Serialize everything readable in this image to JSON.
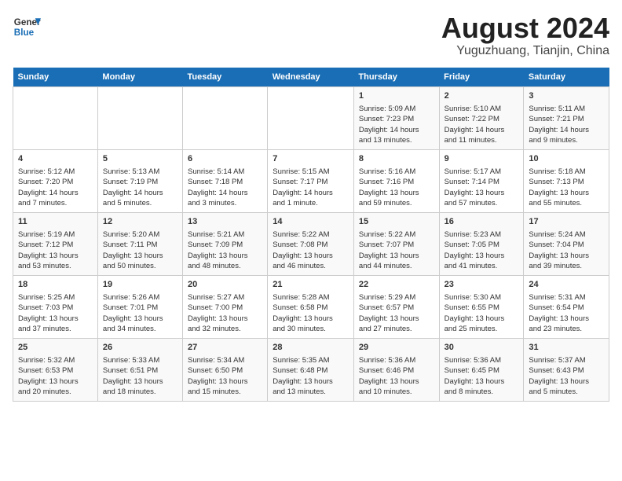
{
  "header": {
    "logo_line1": "General",
    "logo_line2": "Blue",
    "month_year": "August 2024",
    "location": "Yuguzhuang, Tianjin, China"
  },
  "weekdays": [
    "Sunday",
    "Monday",
    "Tuesday",
    "Wednesday",
    "Thursday",
    "Friday",
    "Saturday"
  ],
  "weeks": [
    [
      {
        "day": "",
        "info": ""
      },
      {
        "day": "",
        "info": ""
      },
      {
        "day": "",
        "info": ""
      },
      {
        "day": "",
        "info": ""
      },
      {
        "day": "1",
        "info": "Sunrise: 5:09 AM\nSunset: 7:23 PM\nDaylight: 14 hours\nand 13 minutes."
      },
      {
        "day": "2",
        "info": "Sunrise: 5:10 AM\nSunset: 7:22 PM\nDaylight: 14 hours\nand 11 minutes."
      },
      {
        "day": "3",
        "info": "Sunrise: 5:11 AM\nSunset: 7:21 PM\nDaylight: 14 hours\nand 9 minutes."
      }
    ],
    [
      {
        "day": "4",
        "info": "Sunrise: 5:12 AM\nSunset: 7:20 PM\nDaylight: 14 hours\nand 7 minutes."
      },
      {
        "day": "5",
        "info": "Sunrise: 5:13 AM\nSunset: 7:19 PM\nDaylight: 14 hours\nand 5 minutes."
      },
      {
        "day": "6",
        "info": "Sunrise: 5:14 AM\nSunset: 7:18 PM\nDaylight: 14 hours\nand 3 minutes."
      },
      {
        "day": "7",
        "info": "Sunrise: 5:15 AM\nSunset: 7:17 PM\nDaylight: 14 hours\nand 1 minute."
      },
      {
        "day": "8",
        "info": "Sunrise: 5:16 AM\nSunset: 7:16 PM\nDaylight: 13 hours\nand 59 minutes."
      },
      {
        "day": "9",
        "info": "Sunrise: 5:17 AM\nSunset: 7:14 PM\nDaylight: 13 hours\nand 57 minutes."
      },
      {
        "day": "10",
        "info": "Sunrise: 5:18 AM\nSunset: 7:13 PM\nDaylight: 13 hours\nand 55 minutes."
      }
    ],
    [
      {
        "day": "11",
        "info": "Sunrise: 5:19 AM\nSunset: 7:12 PM\nDaylight: 13 hours\nand 53 minutes."
      },
      {
        "day": "12",
        "info": "Sunrise: 5:20 AM\nSunset: 7:11 PM\nDaylight: 13 hours\nand 50 minutes."
      },
      {
        "day": "13",
        "info": "Sunrise: 5:21 AM\nSunset: 7:09 PM\nDaylight: 13 hours\nand 48 minutes."
      },
      {
        "day": "14",
        "info": "Sunrise: 5:22 AM\nSunset: 7:08 PM\nDaylight: 13 hours\nand 46 minutes."
      },
      {
        "day": "15",
        "info": "Sunrise: 5:22 AM\nSunset: 7:07 PM\nDaylight: 13 hours\nand 44 minutes."
      },
      {
        "day": "16",
        "info": "Sunrise: 5:23 AM\nSunset: 7:05 PM\nDaylight: 13 hours\nand 41 minutes."
      },
      {
        "day": "17",
        "info": "Sunrise: 5:24 AM\nSunset: 7:04 PM\nDaylight: 13 hours\nand 39 minutes."
      }
    ],
    [
      {
        "day": "18",
        "info": "Sunrise: 5:25 AM\nSunset: 7:03 PM\nDaylight: 13 hours\nand 37 minutes."
      },
      {
        "day": "19",
        "info": "Sunrise: 5:26 AM\nSunset: 7:01 PM\nDaylight: 13 hours\nand 34 minutes."
      },
      {
        "day": "20",
        "info": "Sunrise: 5:27 AM\nSunset: 7:00 PM\nDaylight: 13 hours\nand 32 minutes."
      },
      {
        "day": "21",
        "info": "Sunrise: 5:28 AM\nSunset: 6:58 PM\nDaylight: 13 hours\nand 30 minutes."
      },
      {
        "day": "22",
        "info": "Sunrise: 5:29 AM\nSunset: 6:57 PM\nDaylight: 13 hours\nand 27 minutes."
      },
      {
        "day": "23",
        "info": "Sunrise: 5:30 AM\nSunset: 6:55 PM\nDaylight: 13 hours\nand 25 minutes."
      },
      {
        "day": "24",
        "info": "Sunrise: 5:31 AM\nSunset: 6:54 PM\nDaylight: 13 hours\nand 23 minutes."
      }
    ],
    [
      {
        "day": "25",
        "info": "Sunrise: 5:32 AM\nSunset: 6:53 PM\nDaylight: 13 hours\nand 20 minutes."
      },
      {
        "day": "26",
        "info": "Sunrise: 5:33 AM\nSunset: 6:51 PM\nDaylight: 13 hours\nand 18 minutes."
      },
      {
        "day": "27",
        "info": "Sunrise: 5:34 AM\nSunset: 6:50 PM\nDaylight: 13 hours\nand 15 minutes."
      },
      {
        "day": "28",
        "info": "Sunrise: 5:35 AM\nSunset: 6:48 PM\nDaylight: 13 hours\nand 13 minutes."
      },
      {
        "day": "29",
        "info": "Sunrise: 5:36 AM\nSunset: 6:46 PM\nDaylight: 13 hours\nand 10 minutes."
      },
      {
        "day": "30",
        "info": "Sunrise: 5:36 AM\nSunset: 6:45 PM\nDaylight: 13 hours\nand 8 minutes."
      },
      {
        "day": "31",
        "info": "Sunrise: 5:37 AM\nSunset: 6:43 PM\nDaylight: 13 hours\nand 5 minutes."
      }
    ]
  ]
}
